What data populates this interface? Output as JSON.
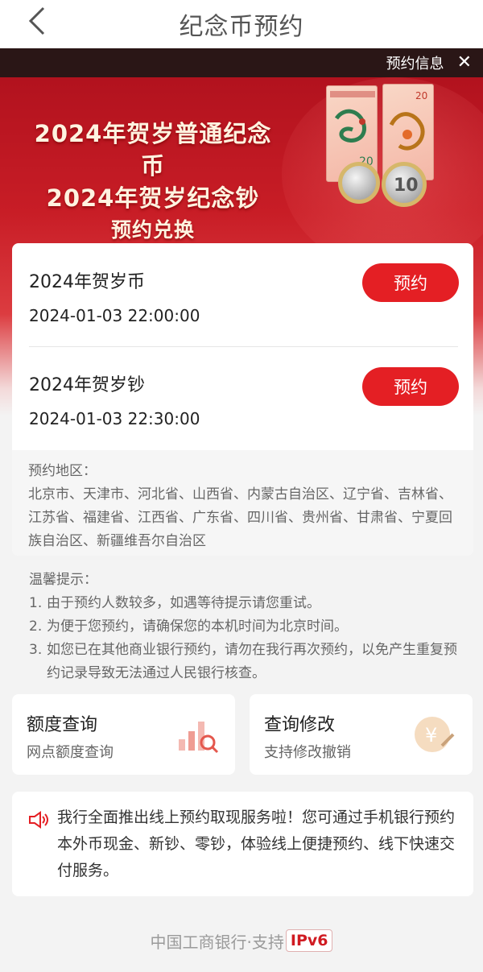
{
  "nav": {
    "title": "纪念币预约",
    "back_icon": "chevron-left-icon"
  },
  "info_bar": {
    "label": "预约信息",
    "close_glyph": "✕"
  },
  "banner": {
    "line1": "2024年贺岁普通纪念币",
    "line2": "2024年贺岁纪念钞",
    "line3": "预约兑换",
    "coin_value": "10",
    "note_value": "20"
  },
  "reservations": [
    {
      "name": "2024年贺岁币",
      "time": "2024-01-03 22:00:00",
      "button": "预约"
    },
    {
      "name": "2024年贺岁钞",
      "time": "2024-01-03 22:30:00",
      "button": "预约"
    }
  ],
  "region": {
    "title": "预约地区：",
    "text": "北京市、天津市、河北省、山西省、内蒙古自治区、辽宁省、吉林省、江苏省、福建省、江西省、广东省、四川省、贵州省、甘肃省、宁夏回族自治区、新疆维吾尔自治区"
  },
  "tips": {
    "title": "温馨提示：",
    "items": [
      {
        "num": "1.",
        "text": "由于预约人数较多，如遇等待提示请您重试。"
      },
      {
        "num": "2.",
        "text": "为便于您预约，请确保您的本机时间为北京时间。"
      },
      {
        "num": "3.",
        "text": "如您已在其他商业银行预约，请勿在我行再次预约，以免产生重复预约记录导致无法通过人民银行核查。"
      }
    ]
  },
  "quick_links": [
    {
      "title": "额度查询",
      "subtitle": "网点额度查询",
      "icon": "quota-chart-search-icon"
    },
    {
      "title": "查询修改",
      "subtitle": "支持修改撤销",
      "icon": "yuan-coin-edit-icon"
    }
  ],
  "notice": {
    "icon": "speaker-icon",
    "text": "我行全面推出线上预约取现服务啦！您可通过手机银行预约本外币现金、新钞、零钞，体验线上便捷预约、线下快速交付服务。"
  },
  "footer": {
    "text": "中国工商银行·支持",
    "badge": "IPv6"
  },
  "colors": {
    "brand_red": "#e41f24",
    "banner_red": "#c81d26",
    "gold": "#d6b76a"
  }
}
